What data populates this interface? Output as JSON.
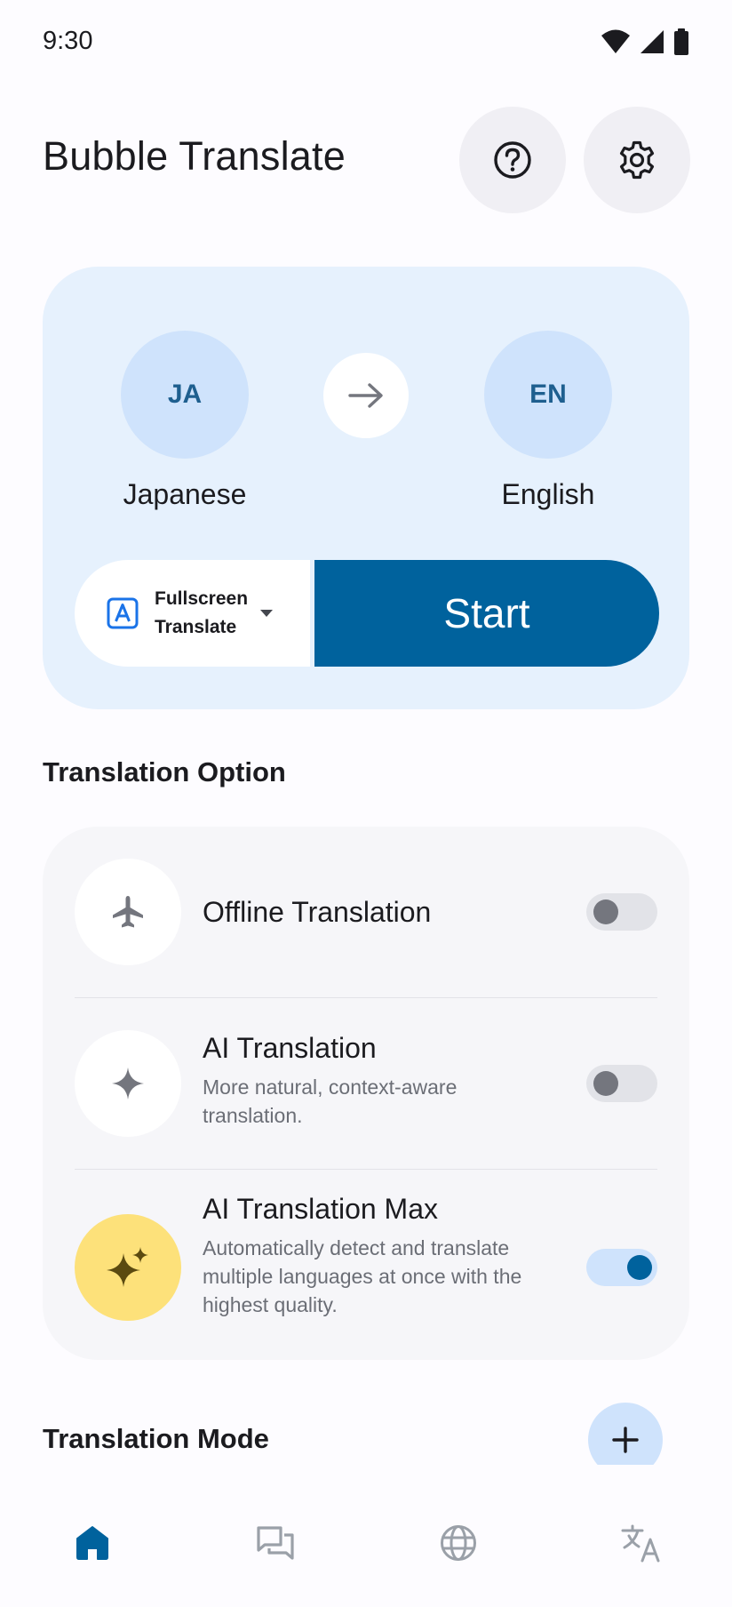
{
  "status_bar": {
    "time": "9:30"
  },
  "header": {
    "title": "Bubble Translate"
  },
  "languages": {
    "source": {
      "code": "JA",
      "name": "Japanese"
    },
    "target": {
      "code": "EN",
      "name": "English"
    }
  },
  "translate_mode": {
    "label_line1": "Fullscreen",
    "label_line2": "Translate",
    "start_label": "Start"
  },
  "translation_option": {
    "section_title": "Translation Option",
    "items": [
      {
        "title": "Offline Translation",
        "description": "",
        "enabled": false,
        "icon": "airplane-icon"
      },
      {
        "title": "AI Translation",
        "description": "More natural, context-aware translation.",
        "enabled": false,
        "icon": "sparkle-icon"
      },
      {
        "title": "AI Translation Max",
        "description": "Automatically detect and translate multiple languages at once with the highest quality.",
        "enabled": true,
        "icon": "sparkles-icon"
      }
    ]
  },
  "translation_mode": {
    "section_title": "Translation Mode"
  },
  "bottom_nav": {
    "items": [
      {
        "icon": "home-icon",
        "active": true
      },
      {
        "icon": "chat-icon",
        "active": false
      },
      {
        "icon": "globe-icon",
        "active": false
      },
      {
        "icon": "translate-icon",
        "active": false
      }
    ]
  },
  "colors": {
    "primary": "#00629d",
    "container": "#e6f1fd",
    "accent_gold": "#fde17a"
  }
}
